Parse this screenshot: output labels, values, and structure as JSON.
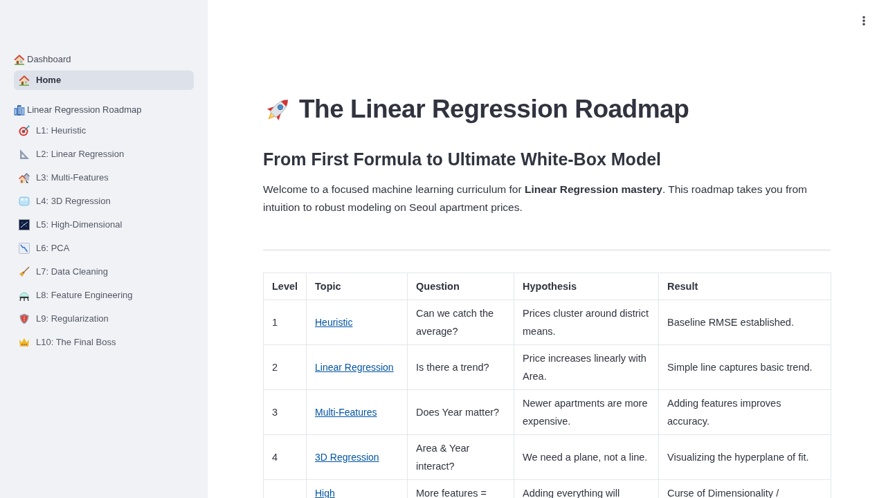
{
  "sidebar": {
    "sections": [
      {
        "header": "Dashboard",
        "items": [
          {
            "label": "Home",
            "selected": true
          }
        ]
      },
      {
        "header": "Linear Regression Roadmap",
        "items": [
          {
            "label": "L1: Heuristic",
            "selected": false
          },
          {
            "label": "L2: Linear Regression",
            "selected": false
          },
          {
            "label": "L3: Multi-Features",
            "selected": false
          },
          {
            "label": "L4: 3D Regression",
            "selected": false
          },
          {
            "label": "L5: High-Dimensional",
            "selected": false
          },
          {
            "label": "L6: PCA",
            "selected": false
          },
          {
            "label": "L7: Data Cleaning",
            "selected": false
          },
          {
            "label": "L8: Feature Engineering",
            "selected": false
          },
          {
            "label": "L9: Regularization",
            "selected": false
          },
          {
            "label": "L10: The Final Boss",
            "selected": false
          }
        ]
      }
    ]
  },
  "main": {
    "title": "The Linear Regression Roadmap",
    "subtitle": "From First Formula to Ultimate White-Box Model",
    "intro": "Welcome to a focused machine learning curriculum for **Linear Regression mastery**. This roadmap takes you from intuition to robust modeling on Seoul apartment prices.",
    "table": {
      "columns": [
        "Level",
        "Topic",
        "Question",
        "Hypothesis",
        "Result"
      ],
      "rows": [
        {
          "level": "1",
          "topic": "Heuristic",
          "question": "Can we catch the average?",
          "hypothesis": "Prices cluster around district means.",
          "result": "Baseline RMSE established."
        },
        {
          "level": "2",
          "topic": "Linear Regression",
          "question": "Is there a trend?",
          "hypothesis": "Price increases linearly with Area.",
          "result": "Simple line captures basic trend."
        },
        {
          "level": "3",
          "topic": "Multi-Features",
          "question": "Does Year matter?",
          "hypothesis": "Newer apartments are more expensive.",
          "result": "Adding features improves accuracy."
        },
        {
          "level": "4",
          "topic": "3D Regression",
          "question": "Area & Year interact?",
          "hypothesis": "We need a plane, not a line.",
          "result": "Visualizing the hyperplane of fit."
        },
        {
          "topic": "High",
          "question": "More features =",
          "hypothesis": "Adding everything will",
          "result": "Curse of Dimensionality /"
        }
      ]
    }
  }
}
